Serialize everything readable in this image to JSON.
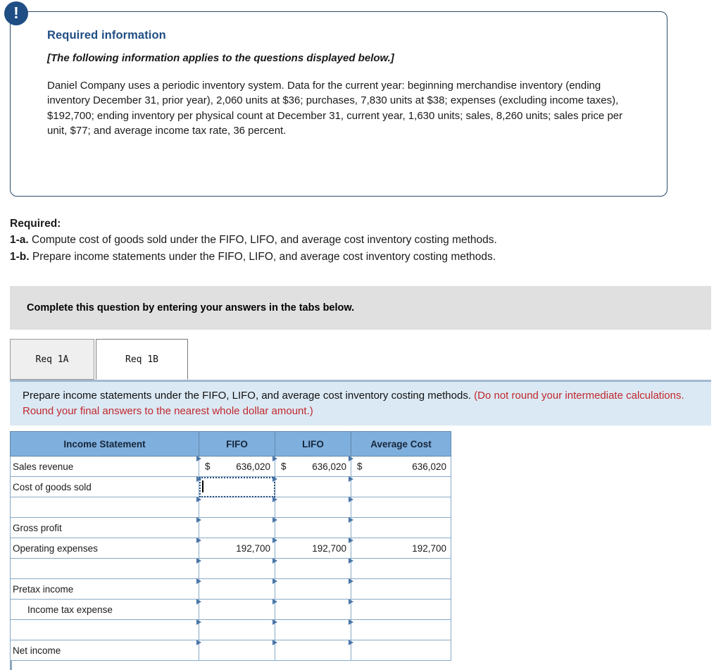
{
  "alert": {
    "icon": "exclamation-icon",
    "glyph": "!"
  },
  "required_info": {
    "heading": "Required information",
    "applies_note": "[The following information applies to the questions displayed below.]",
    "body": "Daniel Company uses a periodic inventory system. Data for the current year: beginning merchandise inventory (ending inventory December 31, prior year), 2,060 units at $36; purchases, 7,830 units at $38; expenses (excluding income taxes), $192,700; ending inventory per physical count at December 31, current year, 1,630 units; sales, 8,260 units; sales price per unit, $77; and average income tax rate, 36 percent."
  },
  "required": {
    "label": "Required:",
    "items": [
      {
        "num": "1-a.",
        "text": "Compute cost of goods sold under the FIFO, LIFO, and average cost inventory costing methods."
      },
      {
        "num": "1-b.",
        "text": "Prepare income statements under the FIFO, LIFO, and average cost inventory costing methods."
      }
    ]
  },
  "complete_band": {
    "text": "Complete this question by entering your answers in the tabs below."
  },
  "tabs": [
    {
      "label": "Req 1A",
      "active": false
    },
    {
      "label": "Req 1B",
      "active": true
    }
  ],
  "prompt": {
    "main": "Prepare income statements under the FIFO, LIFO, and average cost inventory costing methods.",
    "red": "(Do not round your intermediate calculations. Round your final answers to the nearest whole dollar amount.)",
    "red_color": "#c1272d"
  },
  "table": {
    "headers": [
      "Income Statement",
      "FIFO",
      "LIFO",
      "Average Cost"
    ],
    "header_bg": "#7fafdd",
    "rows": [
      {
        "type": "data",
        "label": "Sales revenue",
        "fifo": {
          "currency": "$",
          "value": "636,020"
        },
        "lifo": {
          "currency": "$",
          "value": "636,020"
        },
        "avg": {
          "currency": "$",
          "value": "636,020"
        }
      },
      {
        "type": "data",
        "label": "Cost of goods sold",
        "fifo": {
          "currency": "",
          "value": "",
          "selected": true
        },
        "lifo": {
          "currency": "",
          "value": ""
        },
        "avg": {
          "currency": "",
          "value": ""
        }
      },
      {
        "type": "blank",
        "label": "",
        "fifo": {
          "currency": "",
          "value": ""
        },
        "lifo": {
          "currency": "",
          "value": ""
        },
        "avg": {
          "currency": "",
          "value": ""
        }
      },
      {
        "type": "subtotal",
        "label": "Gross profit",
        "fifo": {
          "currency": "",
          "value": ""
        },
        "lifo": {
          "currency": "",
          "value": ""
        },
        "avg": {
          "currency": "",
          "value": ""
        }
      },
      {
        "type": "data",
        "label": "Operating expenses",
        "fifo": {
          "currency": "",
          "value": "192,700"
        },
        "lifo": {
          "currency": "",
          "value": "192,700"
        },
        "avg": {
          "currency": "",
          "value": "192,700"
        }
      },
      {
        "type": "blank",
        "label": "",
        "fifo": {
          "currency": "",
          "value": ""
        },
        "lifo": {
          "currency": "",
          "value": ""
        },
        "avg": {
          "currency": "",
          "value": ""
        }
      },
      {
        "type": "subtotal",
        "label": "Pretax income",
        "fifo": {
          "currency": "",
          "value": ""
        },
        "lifo": {
          "currency": "",
          "value": ""
        },
        "avg": {
          "currency": "",
          "value": ""
        }
      },
      {
        "type": "data-indent",
        "label": "Income tax expense",
        "fifo": {
          "currency": "",
          "value": ""
        },
        "lifo": {
          "currency": "",
          "value": ""
        },
        "avg": {
          "currency": "",
          "value": ""
        }
      },
      {
        "type": "blank",
        "label": "",
        "fifo": {
          "currency": "",
          "value": ""
        },
        "lifo": {
          "currency": "",
          "value": ""
        },
        "avg": {
          "currency": "",
          "value": ""
        }
      },
      {
        "type": "total",
        "label": "Net income",
        "fifo": {
          "currency": "",
          "value": ""
        },
        "lifo": {
          "currency": "",
          "value": ""
        },
        "avg": {
          "currency": "",
          "value": ""
        }
      }
    ]
  }
}
